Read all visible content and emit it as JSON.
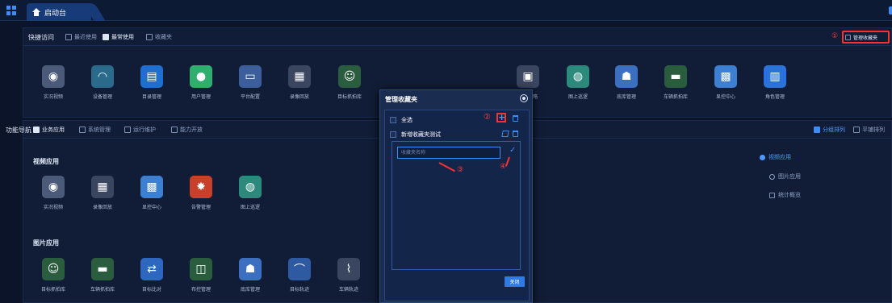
{
  "topbar": {
    "tab_label": "启动台"
  },
  "quick_access": {
    "label": "快捷访问",
    "tabs": [
      {
        "label": "最近使用",
        "active": false
      },
      {
        "label": "最常使用",
        "active": true
      },
      {
        "label": "收藏夹",
        "active": false
      }
    ],
    "annotation_1": "①",
    "manage_favorites": "管理收藏夹",
    "items": [
      {
        "label": "实况视频",
        "icon": "camera-icon"
      },
      {
        "label": "设备管理",
        "icon": "router-icon"
      },
      {
        "label": "目录管理",
        "icon": "catalog-icon"
      },
      {
        "label": "用户管理",
        "icon": "user-icon"
      },
      {
        "label": "平台配置",
        "icon": "server-icon"
      },
      {
        "label": "录像回放",
        "icon": "film-icon"
      },
      {
        "label": "目标抓拍库",
        "icon": "face-capture-icon"
      },
      {
        "label": "存储策略",
        "icon": "storage-icon"
      },
      {
        "label": "图上巡逻",
        "icon": "map-patrol-icon"
      },
      {
        "label": "底库管理",
        "icon": "base-library-icon"
      },
      {
        "label": "车辆抓拍库",
        "icon": "vehicle-capture-icon"
      },
      {
        "label": "显控中心",
        "icon": "display-icon"
      },
      {
        "label": "角色管理",
        "icon": "role-icon"
      }
    ]
  },
  "func_nav": {
    "label": "功能导航",
    "tabs": [
      {
        "label": "业务应用",
        "active": true
      },
      {
        "label": "系统管理",
        "active": false
      },
      {
        "label": "运行维护",
        "active": false
      },
      {
        "label": "能力开放",
        "active": false
      }
    ],
    "layout_options": [
      "分组排列",
      "平铺排列"
    ],
    "video_section": "视频应用",
    "video_items": [
      {
        "label": "实况视频",
        "icon": "camera-icon"
      },
      {
        "label": "录像回放",
        "icon": "film-icon"
      },
      {
        "label": "显控中心",
        "icon": "display-icon"
      },
      {
        "label": "告警管理",
        "icon": "alarm-icon"
      },
      {
        "label": "图上巡逻",
        "icon": "map-patrol-icon"
      }
    ],
    "image_section": "图片应用",
    "image_items": [
      {
        "label": "目标抓拍库",
        "icon": "face-capture-icon"
      },
      {
        "label": "车辆抓拍库",
        "icon": "vehicle-capture-icon"
      },
      {
        "label": "目标比对",
        "icon": "compare-icon"
      },
      {
        "label": "布控管理",
        "icon": "control-icon"
      },
      {
        "label": "底库管理",
        "icon": "base-library-icon"
      },
      {
        "label": "目标轨迹",
        "icon": "target-track-icon"
      },
      {
        "label": "车辆轨迹",
        "icon": "vehicle-track-icon"
      }
    ],
    "right_nav": [
      {
        "label": "视频应用",
        "active": true
      },
      {
        "label": "图片应用",
        "active": false
      },
      {
        "label": "统计概览",
        "active": false
      }
    ]
  },
  "modal": {
    "title": "管理收藏夹",
    "select_all": "全选",
    "annotation_2": "②",
    "folder_name": "新增收藏夹测试",
    "input_placeholder": "收藏夹名称",
    "annotation_3": "③",
    "annotation_4": "④",
    "close_label": "关闭"
  },
  "colors": {
    "accent": "#3d8df5",
    "annotation": "#ff3030",
    "background": "#0b1428"
  }
}
